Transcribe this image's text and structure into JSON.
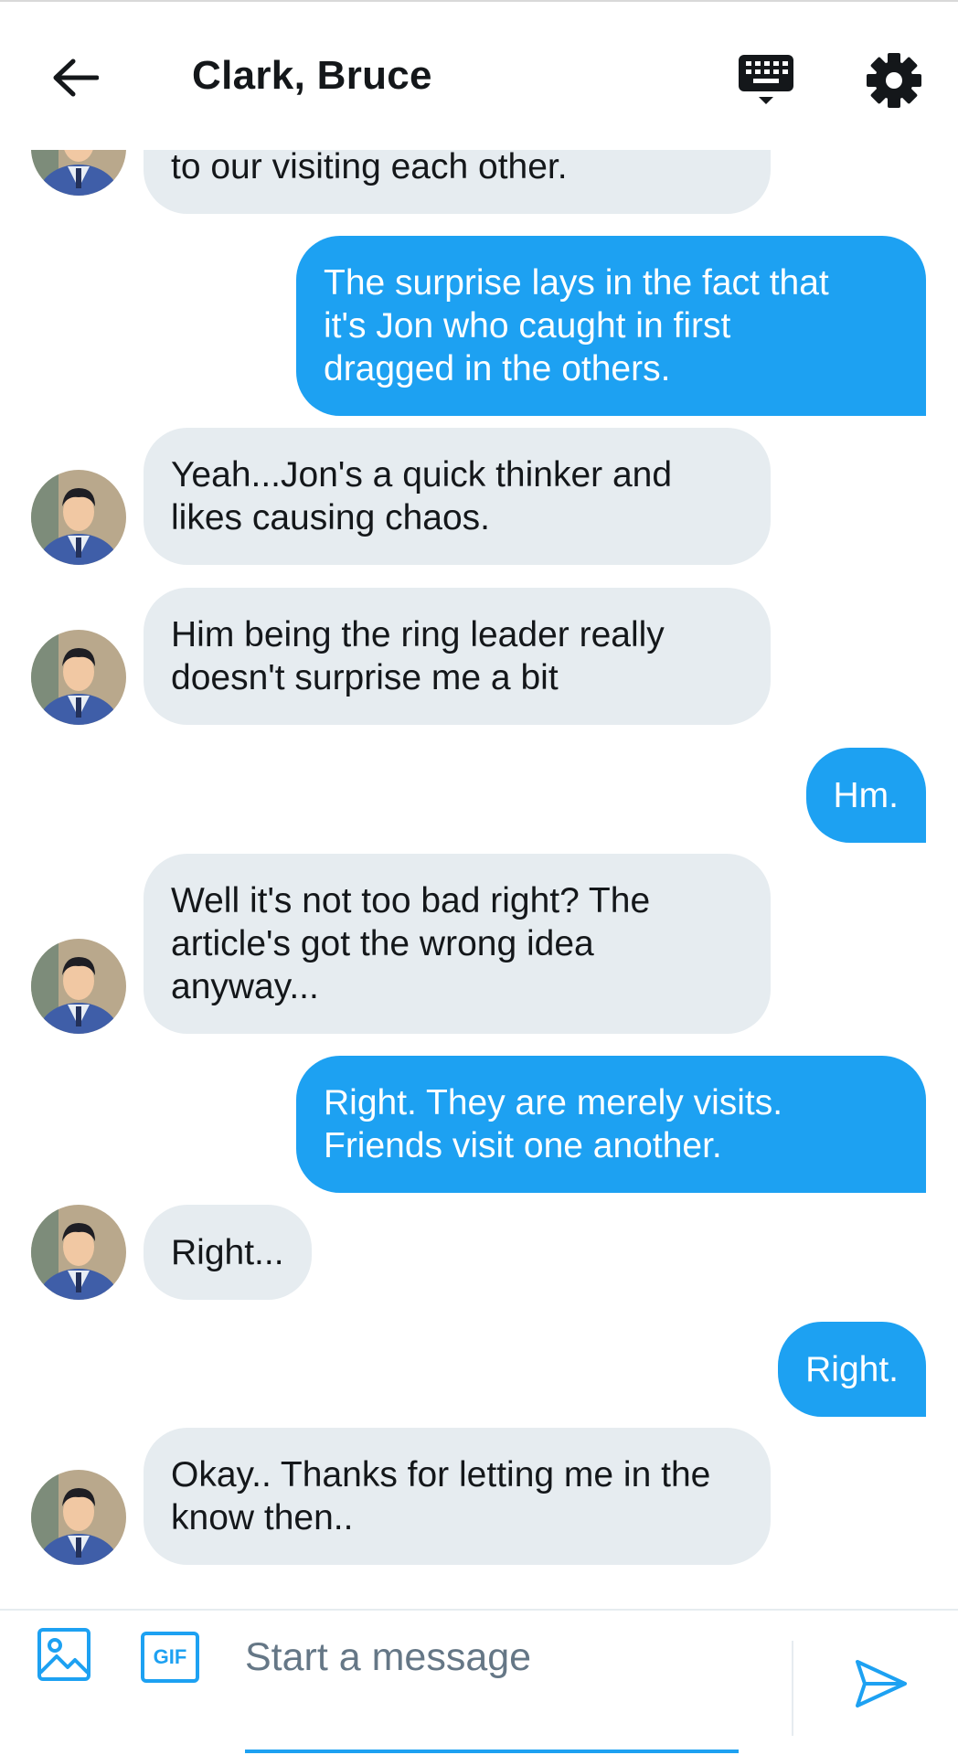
{
  "header": {
    "title": "Clark, Bruce",
    "back_icon": "arrow-left-icon",
    "keyboard_icon": "keyboard-icon",
    "settings_icon": "gear-icon"
  },
  "colors": {
    "accent": "#1da1f2",
    "incoming_bubble": "#e6ecf0",
    "text": "#14171a",
    "placeholder": "#657786"
  },
  "messages": [
    {
      "from": "them",
      "text": "to our visiting each other."
    },
    {
      "from": "me",
      "text": "The surprise lays in the fact that\nit's Jon who caught in first\ndragged in the others."
    },
    {
      "from": "them",
      "text": "Yeah...Jon's a quick thinker and\nlikes causing chaos."
    },
    {
      "from": "them",
      "text": "Him being the ring leader really\ndoesn't surprise me a bit"
    },
    {
      "from": "me",
      "text": "Hm."
    },
    {
      "from": "them",
      "text": "Well it's not too bad right?  The\narticle's got the wrong idea\nanyway..."
    },
    {
      "from": "me",
      "text": "Right. They are merely visits.\nFriends visit one another."
    },
    {
      "from": "them",
      "text": "Right..."
    },
    {
      "from": "me",
      "text": "Right."
    },
    {
      "from": "them",
      "text": "Okay.. Thanks for letting me in the\nknow then.."
    }
  ],
  "composer": {
    "placeholder": "Start a message",
    "gif_label": "GIF",
    "image_icon": "image-icon",
    "send_icon": "send-icon"
  }
}
